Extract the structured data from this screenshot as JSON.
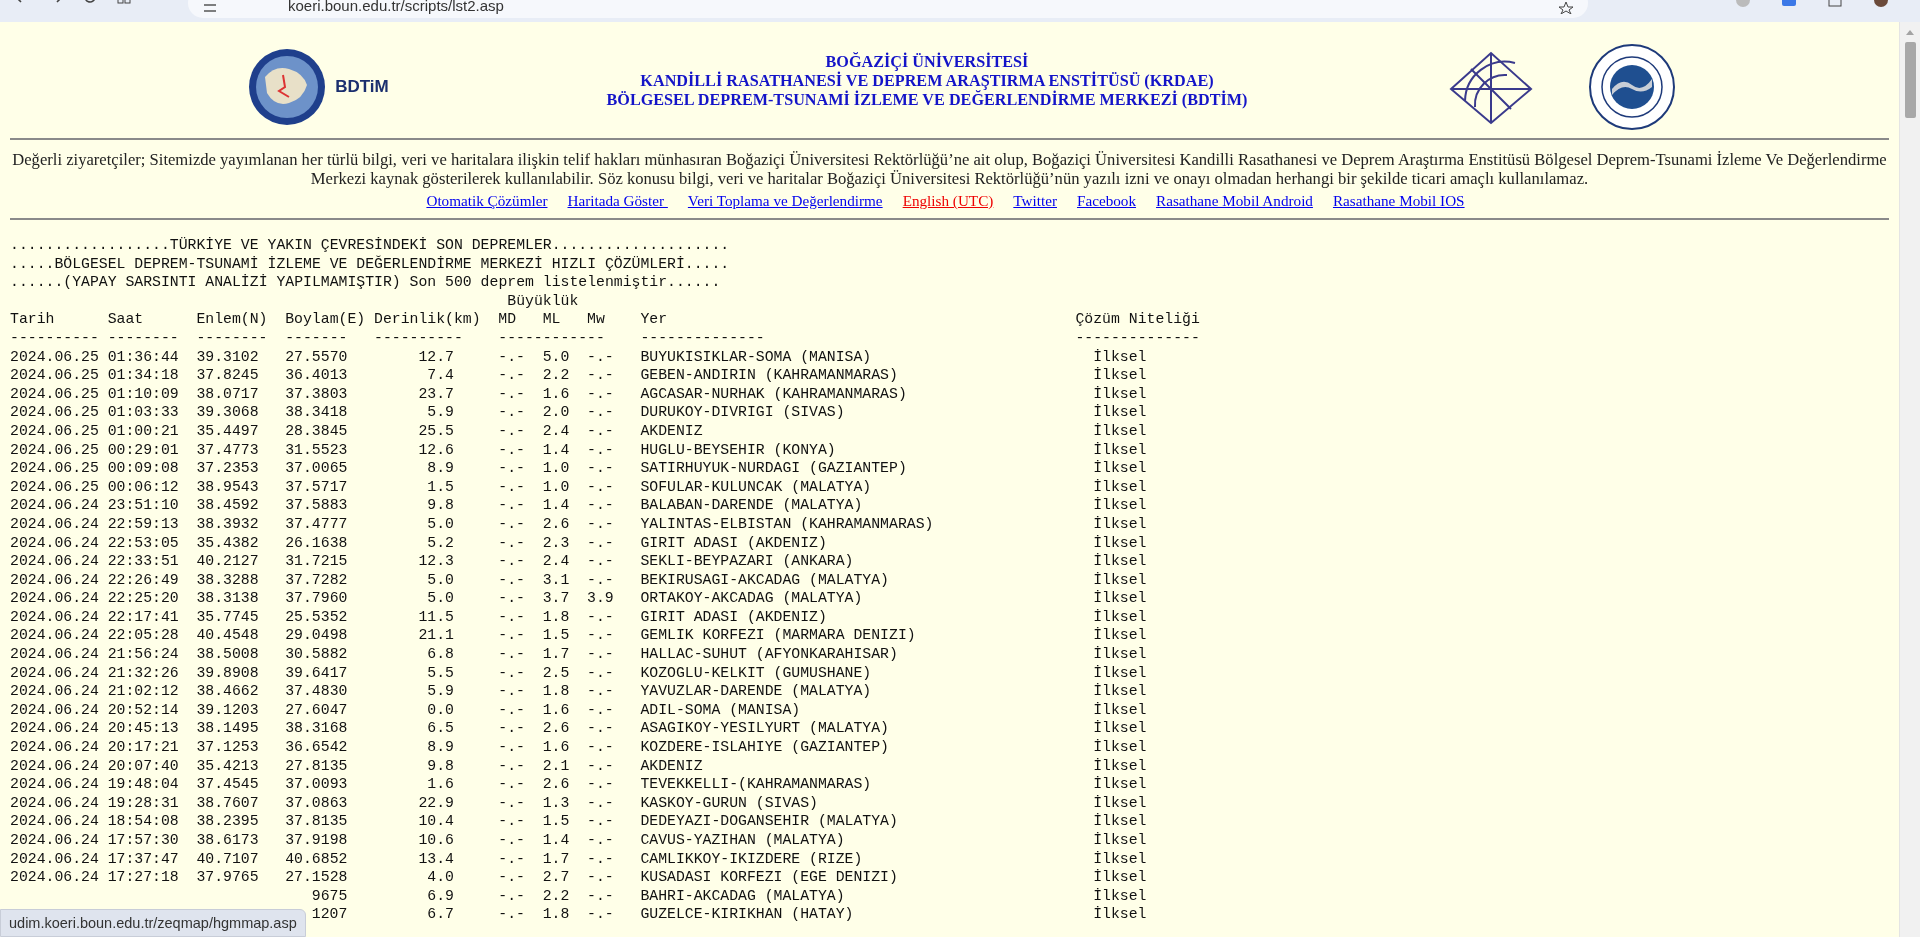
{
  "browser": {
    "address": "koeri.boun.edu.tr/scripts/lst2.asp"
  },
  "header": {
    "logo_text": "BDTiM",
    "title_lines": [
      "BOĞAZİÇİ ÜNİVERSİTESİ",
      "KANDİLLİ RASATHANESİ VE DEPREM ARAŞTIRMA ENSTİTÜSÜ (KRDAE)",
      "BÖLGESEL DEPREM-TSUNAMİ İZLEME VE DEĞERLENDİRME MERKEZİ (BDTİM)"
    ]
  },
  "notice": "Değerli ziyaretçiler; Sitemizde yayımlanan her türlü bilgi, veri ve haritalara ilişkin telif hakları münhasıran Boğaziçi Üniversitesi Rektörlüğü’ne ait olup, Boğaziçi Üniversitesi Kandilli Rasathanesi ve Deprem Araştırma Enstitüsü Bölgesel Deprem-Tsunami İzleme Ve Değerlendirme Merkezi kaynak gösterilerek kullanılabilir. Söz konusu bilgi, veri ve haritalar Boğaziçi Üniversitesi Rektörlüğü’nün yazılı izni ve onayı olmadan herhangi bir şekilde ticari amaçlı kullanılamaz.",
  "links": [
    {
      "label": "Otomatik Çözümler",
      "color": "#0000ee"
    },
    {
      "label": "Haritada Göster ",
      "color": "#0000ee"
    },
    {
      "label": "Veri Toplama ve Değerlendirme",
      "color": "#0000ee"
    },
    {
      "label": "English (UTC)",
      "color": "#ee0000"
    },
    {
      "label": "Twitter",
      "color": "#0000ee"
    },
    {
      "label": "Facebook",
      "color": "#0000ee"
    },
    {
      "label": "Rasathane Mobil Android",
      "color": "#0000ee"
    },
    {
      "label": "Rasathane Mobil IOS",
      "color": "#0000ee"
    }
  ],
  "list": {
    "headings": [
      "..................TÜRKİYE VE YAKIN ÇEVRESİNDEKİ SON DEPREMLER....................",
      ".....BÖLGESEL DEPREM-TSUNAMİ İZLEME VE DEĞERLENDİRME MERKEZİ HIZLI ÇÖZÜMLERİ.....",
      "......(YAPAY SARSINTI ANALİZİ YAPILMAMIŞTIR) Son 500 deprem listelenmiştir......"
    ],
    "group_label": "Büyüklük",
    "columns": [
      "Tarih",
      "Saat",
      "Enlem(N)",
      "Boylam(E)",
      "Derinlik(km)",
      "MD",
      "ML",
      "Mw",
      "Yer",
      "Çözüm Niteliği"
    ],
    "rules": [
      "----------",
      "--------",
      "--------",
      "-------",
      "----------",
      "------------",
      "--------------",
      "--------------"
    ],
    "rows": [
      {
        "date": "2024.06.25",
        "time": "01:36:44",
        "lat": "39.3102",
        "lon": "27.5570",
        "depth": "12.7",
        "md": "-.-",
        "ml": "5.0",
        "mw": "-.-",
        "place": "BUYUKISIKLAR-SOMA (MANISA)",
        "quality": "İlksel"
      },
      {
        "date": "2024.06.25",
        "time": "01:34:18",
        "lat": "37.8245",
        "lon": "36.4013",
        "depth": "7.4",
        "md": "-.-",
        "ml": "2.2",
        "mw": "-.-",
        "place": "GEBEN-ANDIRIN (KAHRAMANMARAS)",
        "quality": "İlksel"
      },
      {
        "date": "2024.06.25",
        "time": "01:10:09",
        "lat": "38.0717",
        "lon": "37.3803",
        "depth": "23.7",
        "md": "-.-",
        "ml": "1.6",
        "mw": "-.-",
        "place": "AGCASAR-NURHAK (KAHRAMANMARAS)",
        "quality": "İlksel"
      },
      {
        "date": "2024.06.25",
        "time": "01:03:33",
        "lat": "39.3068",
        "lon": "38.3418",
        "depth": "5.9",
        "md": "-.-",
        "ml": "2.0",
        "mw": "-.-",
        "place": "DURUKOY-DIVRIGI (SIVAS)",
        "quality": "İlksel"
      },
      {
        "date": "2024.06.25",
        "time": "01:00:21",
        "lat": "35.4497",
        "lon": "28.3845",
        "depth": "25.5",
        "md": "-.-",
        "ml": "2.4",
        "mw": "-.-",
        "place": "AKDENIZ",
        "quality": "İlksel"
      },
      {
        "date": "2024.06.25",
        "time": "00:29:01",
        "lat": "37.4773",
        "lon": "31.5523",
        "depth": "12.6",
        "md": "-.-",
        "ml": "1.4",
        "mw": "-.-",
        "place": "HUGLU-BEYSEHIR (KONYA)",
        "quality": "İlksel"
      },
      {
        "date": "2024.06.25",
        "time": "00:09:08",
        "lat": "37.2353",
        "lon": "37.0065",
        "depth": "8.9",
        "md": "-.-",
        "ml": "1.0",
        "mw": "-.-",
        "place": "SATIRHUYUK-NURDAGI (GAZIANTEP)",
        "quality": "İlksel"
      },
      {
        "date": "2024.06.25",
        "time": "00:06:12",
        "lat": "38.9543",
        "lon": "37.5717",
        "depth": "1.5",
        "md": "-.-",
        "ml": "1.0",
        "mw": "-.-",
        "place": "SOFULAR-KULUNCAK (MALATYA)",
        "quality": "İlksel"
      },
      {
        "date": "2024.06.24",
        "time": "23:51:10",
        "lat": "38.4592",
        "lon": "37.5883",
        "depth": "9.8",
        "md": "-.-",
        "ml": "1.4",
        "mw": "-.-",
        "place": "BALABAN-DARENDE (MALATYA)",
        "quality": "İlksel"
      },
      {
        "date": "2024.06.24",
        "time": "22:59:13",
        "lat": "38.3932",
        "lon": "37.4777",
        "depth": "5.0",
        "md": "-.-",
        "ml": "2.6",
        "mw": "-.-",
        "place": "YALINTAS-ELBISTAN (KAHRAMANMARAS)",
        "quality": "İlksel"
      },
      {
        "date": "2024.06.24",
        "time": "22:53:05",
        "lat": "35.4382",
        "lon": "26.1638",
        "depth": "5.2",
        "md": "-.-",
        "ml": "2.3",
        "mw": "-.-",
        "place": "GIRIT ADASI (AKDENIZ)",
        "quality": "İlksel"
      },
      {
        "date": "2024.06.24",
        "time": "22:33:51",
        "lat": "40.2127",
        "lon": "31.7215",
        "depth": "12.3",
        "md": "-.-",
        "ml": "2.4",
        "mw": "-.-",
        "place": "SEKLI-BEYPAZARI (ANKARA)",
        "quality": "İlksel"
      },
      {
        "date": "2024.06.24",
        "time": "22:26:49",
        "lat": "38.3288",
        "lon": "37.7282",
        "depth": "5.0",
        "md": "-.-",
        "ml": "3.1",
        "mw": "-.-",
        "place": "BEKIRUSAGI-AKCADAG (MALATYA)",
        "quality": "İlksel"
      },
      {
        "date": "2024.06.24",
        "time": "22:25:20",
        "lat": "38.3138",
        "lon": "37.7960",
        "depth": "5.0",
        "md": "-.-",
        "ml": "3.7",
        "mw": "3.9",
        "place": "ORTAKOY-AKCADAG (MALATYA)",
        "quality": "İlksel"
      },
      {
        "date": "2024.06.24",
        "time": "22:17:41",
        "lat": "35.7745",
        "lon": "25.5352",
        "depth": "11.5",
        "md": "-.-",
        "ml": "1.8",
        "mw": "-.-",
        "place": "GIRIT ADASI (AKDENIZ)",
        "quality": "İlksel"
      },
      {
        "date": "2024.06.24",
        "time": "22:05:28",
        "lat": "40.4548",
        "lon": "29.0498",
        "depth": "21.1",
        "md": "-.-",
        "ml": "1.5",
        "mw": "-.-",
        "place": "GEMLIK KORFEZI (MARMARA DENIZI)",
        "quality": "İlksel"
      },
      {
        "date": "2024.06.24",
        "time": "21:56:24",
        "lat": "38.5008",
        "lon": "30.5882",
        "depth": "6.8",
        "md": "-.-",
        "ml": "1.7",
        "mw": "-.-",
        "place": "HALLAC-SUHUT (AFYONKARAHISAR)",
        "quality": "İlksel"
      },
      {
        "date": "2024.06.24",
        "time": "21:32:26",
        "lat": "39.8908",
        "lon": "39.6417",
        "depth": "5.5",
        "md": "-.-",
        "ml": "2.5",
        "mw": "-.-",
        "place": "KOZOGLU-KELKIT (GUMUSHANE)",
        "quality": "İlksel"
      },
      {
        "date": "2024.06.24",
        "time": "21:02:12",
        "lat": "38.4662",
        "lon": "37.4830",
        "depth": "5.9",
        "md": "-.-",
        "ml": "1.8",
        "mw": "-.-",
        "place": "YAVUZLAR-DARENDE (MALATYA)",
        "quality": "İlksel"
      },
      {
        "date": "2024.06.24",
        "time": "20:52:14",
        "lat": "39.1203",
        "lon": "27.6047",
        "depth": "0.0",
        "md": "-.-",
        "ml": "1.6",
        "mw": "-.-",
        "place": "ADIL-SOMA (MANISA)",
        "quality": "İlksel"
      },
      {
        "date": "2024.06.24",
        "time": "20:45:13",
        "lat": "38.1495",
        "lon": "38.3168",
        "depth": "6.5",
        "md": "-.-",
        "ml": "2.6",
        "mw": "-.-",
        "place": "ASAGIKOY-YESILYURT (MALATYA)",
        "quality": "İlksel"
      },
      {
        "date": "2024.06.24",
        "time": "20:17:21",
        "lat": "37.1253",
        "lon": "36.6542",
        "depth": "8.9",
        "md": "-.-",
        "ml": "1.6",
        "mw": "-.-",
        "place": "KOZDERE-ISLAHIYE (GAZIANTEP)",
        "quality": "İlksel"
      },
      {
        "date": "2024.06.24",
        "time": "20:07:40",
        "lat": "35.4213",
        "lon": "27.8135",
        "depth": "9.8",
        "md": "-.-",
        "ml": "2.1",
        "mw": "-.-",
        "place": "AKDENIZ",
        "quality": "İlksel"
      },
      {
        "date": "2024.06.24",
        "time": "19:48:04",
        "lat": "37.4545",
        "lon": "37.0093",
        "depth": "1.6",
        "md": "-.-",
        "ml": "2.6",
        "mw": "-.-",
        "place": "TEVEKKELLI-(KAHRAMANMARAS)",
        "quality": "İlksel"
      },
      {
        "date": "2024.06.24",
        "time": "19:28:31",
        "lat": "38.7607",
        "lon": "37.0863",
        "depth": "22.9",
        "md": "-.-",
        "ml": "1.3",
        "mw": "-.-",
        "place": "KASKOY-GURUN (SIVAS)",
        "quality": "İlksel"
      },
      {
        "date": "2024.06.24",
        "time": "18:54:08",
        "lat": "38.2395",
        "lon": "37.8135",
        "depth": "10.4",
        "md": "-.-",
        "ml": "1.5",
        "mw": "-.-",
        "place": "DEDEYAZI-DOGANSEHIR (MALATYA)",
        "quality": "İlksel"
      },
      {
        "date": "2024.06.24",
        "time": "17:57:30",
        "lat": "38.6173",
        "lon": "37.9198",
        "depth": "10.6",
        "md": "-.-",
        "ml": "1.4",
        "mw": "-.-",
        "place": "CAVUS-YAZIHAN (MALATYA)",
        "quality": "İlksel"
      },
      {
        "date": "2024.06.24",
        "time": "17:37:47",
        "lat": "40.7107",
        "lon": "40.6852",
        "depth": "13.4",
        "md": "-.-",
        "ml": "1.7",
        "mw": "-.-",
        "place": "CAMLIKKOY-IKIZDERE (RIZE)",
        "quality": "İlksel"
      },
      {
        "date": "2024.06.24",
        "time": "17:27:18",
        "lat": "37.9765",
        "lon": "27.1528",
        "depth": "4.0",
        "md": "-.-",
        "ml": "2.7",
        "mw": "-.-",
        "place": "KUSADASI KORFEZI (EGE DENIZI)",
        "quality": "İlksel"
      },
      {
        "lon": "9675",
        "depth": "6.9",
        "md": "-.-",
        "ml": "2.2",
        "mw": "-.-",
        "place": "BAHRI-AKCADAG (MALATYA)",
        "quality": "İlksel"
      },
      {
        "lon": "1207",
        "depth": "6.7",
        "md": "-.-",
        "ml": "1.8",
        "mw": "-.-",
        "place": "GUZELCE-KIRIKHAN (HATAY)",
        "quality": "İlksel"
      }
    ]
  },
  "status_bar": {
    "url": "udim.koeri.boun.edu.tr/zeqmap/hgmmap.asp"
  }
}
